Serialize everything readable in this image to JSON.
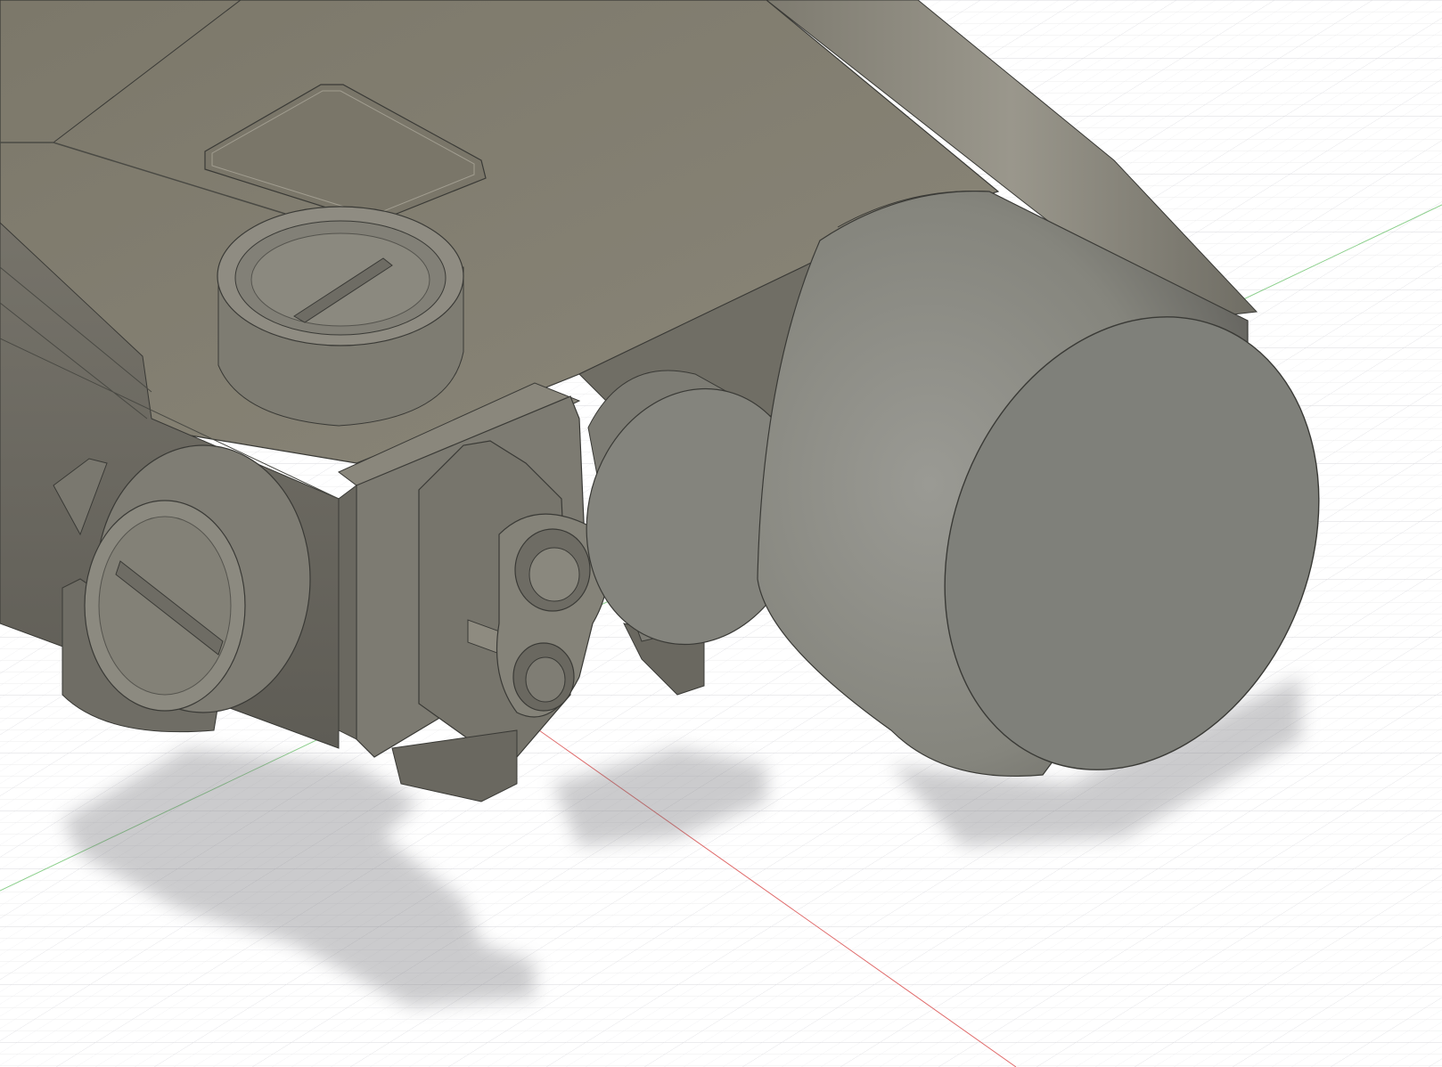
{
  "viewport": {
    "view": "3d-model-canvas",
    "background_color": "#ffffff",
    "grid_color": "#d4d4d8",
    "grid_minor_color": "#ececee",
    "x_axis_color": "#e06b6b",
    "y_axis_color": "#6fc46f"
  },
  "model": {
    "body_color": "#7e7a6d",
    "body_light_color": "#8f8b7e",
    "body_dark_color": "#5f5d55",
    "lens_face_color": "#7f807a",
    "lens_side_color": "#8a8a84",
    "edge_color": "#3a3a36"
  },
  "icons": {
    "shadow": "ground-shadow",
    "grid": "ground-grid"
  }
}
